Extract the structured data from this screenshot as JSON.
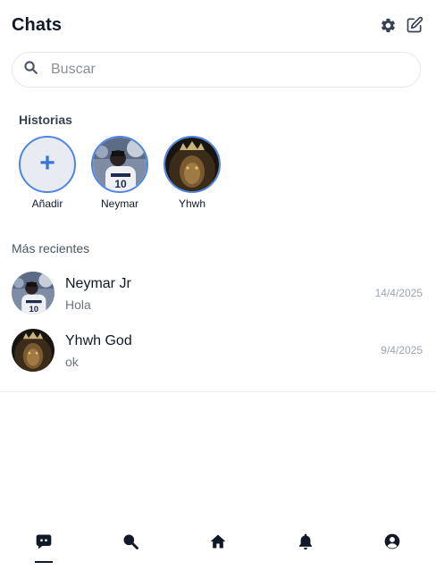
{
  "header": {
    "title": "Chats",
    "settings_icon": "gear-icon",
    "compose_icon": "compose-icon"
  },
  "search": {
    "placeholder": "Buscar",
    "value": "",
    "icon": "search-icon"
  },
  "stories": {
    "title": "Historias",
    "items": [
      {
        "label": "Añadir",
        "kind": "add",
        "symbol": "+"
      },
      {
        "label": "Neymar",
        "kind": "user"
      },
      {
        "label": "Yhwh",
        "kind": "user"
      }
    ]
  },
  "recent": {
    "title": "Más recientes",
    "chats": [
      {
        "name": "Neymar Jr",
        "preview": "Hola",
        "date": "14/4/2025"
      },
      {
        "name": "Yhwh God",
        "preview": "ok",
        "date": "9/4/2025"
      }
    ]
  },
  "nav": {
    "items": [
      {
        "icon": "chat-icon",
        "active": true
      },
      {
        "icon": "search-icon",
        "active": false
      },
      {
        "icon": "home-icon",
        "active": false
      },
      {
        "icon": "bell-icon",
        "active": false
      },
      {
        "icon": "profile-icon",
        "active": false
      }
    ]
  },
  "colors": {
    "accent": "#4f86e3",
    "text": "#111827",
    "muted": "#6b7280"
  }
}
